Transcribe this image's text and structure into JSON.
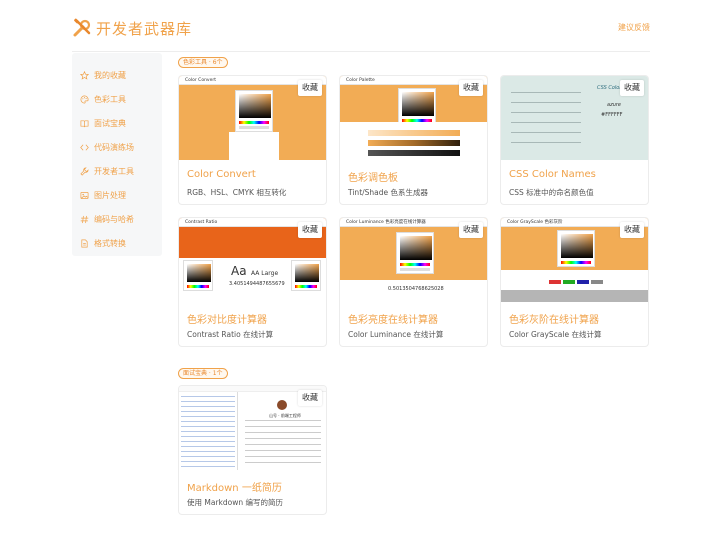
{
  "header": {
    "title": "开发者武器库",
    "feedback": "建议反馈"
  },
  "sidebar": {
    "items": [
      {
        "label": "我的收藏",
        "icon": "star-icon"
      },
      {
        "label": "色彩工具",
        "icon": "palette-icon"
      },
      {
        "label": "面试宝典",
        "icon": "book-icon"
      },
      {
        "label": "代码演练场",
        "icon": "code-icon"
      },
      {
        "label": "开发者工具",
        "icon": "wrench-icon"
      },
      {
        "label": "图片处理",
        "icon": "image-icon"
      },
      {
        "label": "编码与哈希",
        "icon": "hash-icon"
      },
      {
        "label": "格式转换",
        "icon": "file-icon"
      }
    ]
  },
  "sections": [
    {
      "badge": "色彩工具 · 6个",
      "cards": [
        {
          "title": "Color Convert",
          "desc": "RGB、HSL、CMYK 相互转化",
          "collect": "收藏",
          "thumb_label": "Color Convert"
        },
        {
          "title": "色彩调色板",
          "desc": "Tint/Shade 色系生成器",
          "collect": "收藏",
          "thumb_label": "Color Palette"
        },
        {
          "title": "CSS Color Names",
          "desc": "CSS 标准中的命名颜色值",
          "collect": "收藏",
          "thumb_label": "CSS Color",
          "thumb_value": "#FFFFFF",
          "thumb_name": "azure"
        },
        {
          "title": "色彩对比度计算器",
          "desc": "Contrast Ratio 在线计算",
          "collect": "收藏",
          "thumb_label": "Contrast Ratio",
          "thumb_value": "3.4051494487655679",
          "thumb_sample": "Aa",
          "thumb_sample_small": "AA Large"
        },
        {
          "title": "色彩亮度在线计算器",
          "desc": "Color Luminance 在线计算",
          "collect": "收藏",
          "thumb_label": "Color Luminance 色彩亮度在线计算器",
          "thumb_value": "0.5013504768625028"
        },
        {
          "title": "色彩灰阶在线计算器",
          "desc": "Color GrayScale 在线计算",
          "collect": "收藏",
          "thumb_label": "Color GrayScale 色彩灰阶"
        }
      ]
    },
    {
      "badge": "面试宝典 · 1个",
      "cards": [
        {
          "title": "Markdown 一纸简历",
          "desc": "使用 Markdown 编写的简历",
          "collect": "收藏",
          "thumb_label": "山号 · 前端工程师"
        }
      ]
    }
  ],
  "colors": {
    "accent": "#f0a24a",
    "thumb_orange": "#f2ac55",
    "contrast_bg": "#e8641a"
  }
}
